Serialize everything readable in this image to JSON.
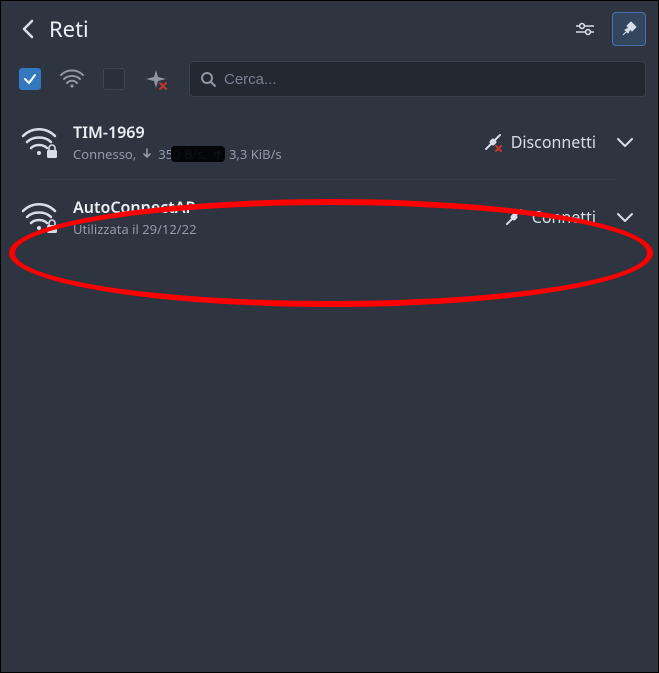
{
  "header": {
    "title": "Reti"
  },
  "search": {
    "placeholder": "Cerca...",
    "value": ""
  },
  "filters": {
    "wifi_checked": true,
    "airplane_checked": false
  },
  "networks": [
    {
      "name": "TIM-1969",
      "status_prefix": "Connesso,",
      "down_rate": "350 B/s,",
      "up_rate": "3,3 KiB/s",
      "action_label": "Disconnetti",
      "connected": true
    },
    {
      "name": "AutoConnectAP",
      "status_line": "Utilizzata il 29/12/22",
      "action_label": "Connetti",
      "connected": false
    }
  ]
}
